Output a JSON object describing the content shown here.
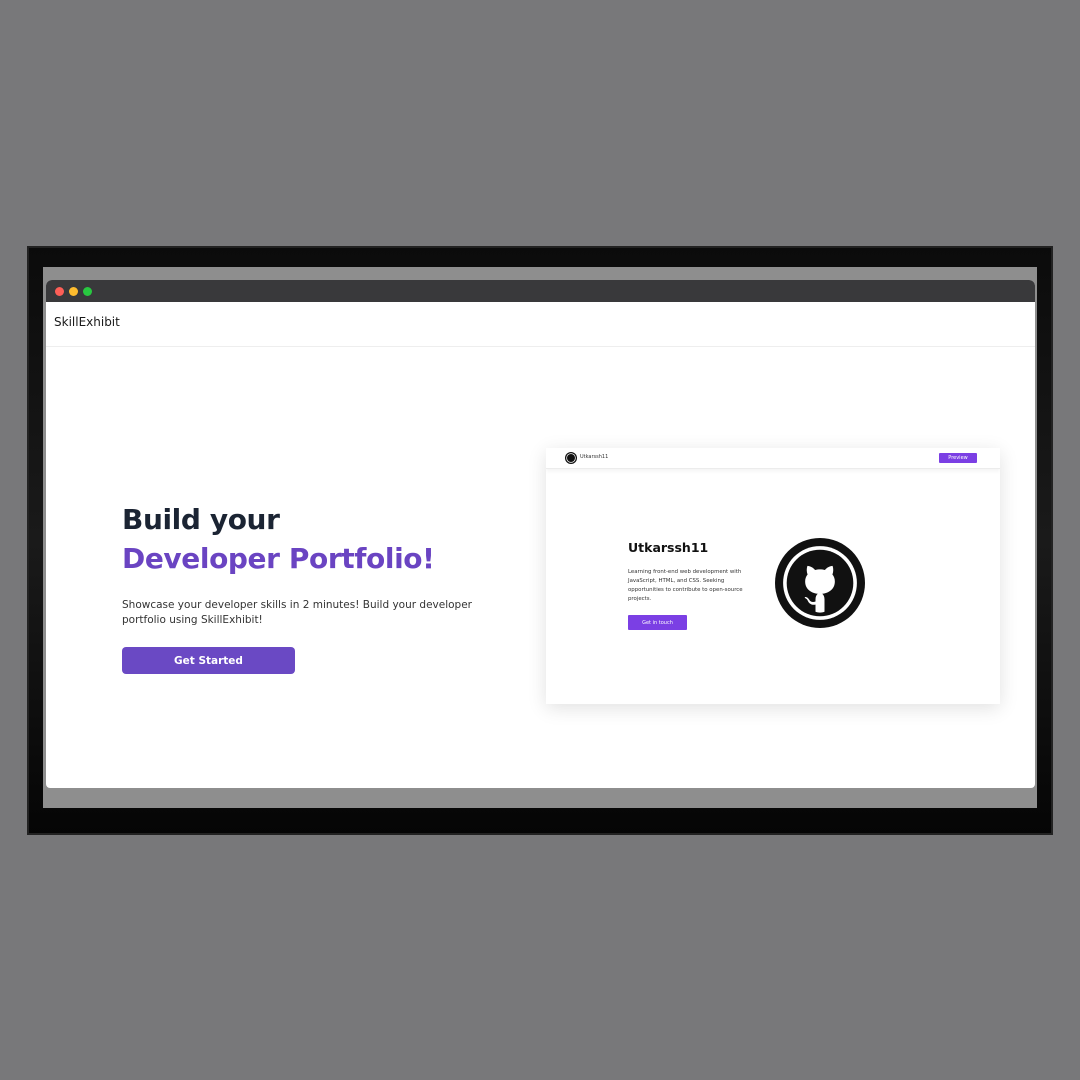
{
  "site": {
    "brand": "SkillExhibit"
  },
  "hero": {
    "title_line1": "Build your",
    "title_line2": "Developer Portfolio!",
    "description": "Showcase your developer skills in 2 minutes! Build your developer portfolio using SkillExhibit!",
    "cta_label": "Get Started"
  },
  "preview": {
    "nav_username": "Utkarssh11",
    "preview_button": "Preview",
    "name": "Utkarssh11",
    "bio": "Learning front-end web development with JavaScript, HTML, and CSS. Seeking opportunities to contribute to open-source projects.",
    "contact_button": "Get in touch",
    "avatar_icon": "github-icon"
  },
  "colors": {
    "accent": "#6a49c4",
    "heading": "#1b2433",
    "preview_accent": "#7b3fe4",
    "background": "#78787a"
  },
  "window_controls": [
    "close-icon",
    "minimize-icon",
    "maximize-icon"
  ]
}
